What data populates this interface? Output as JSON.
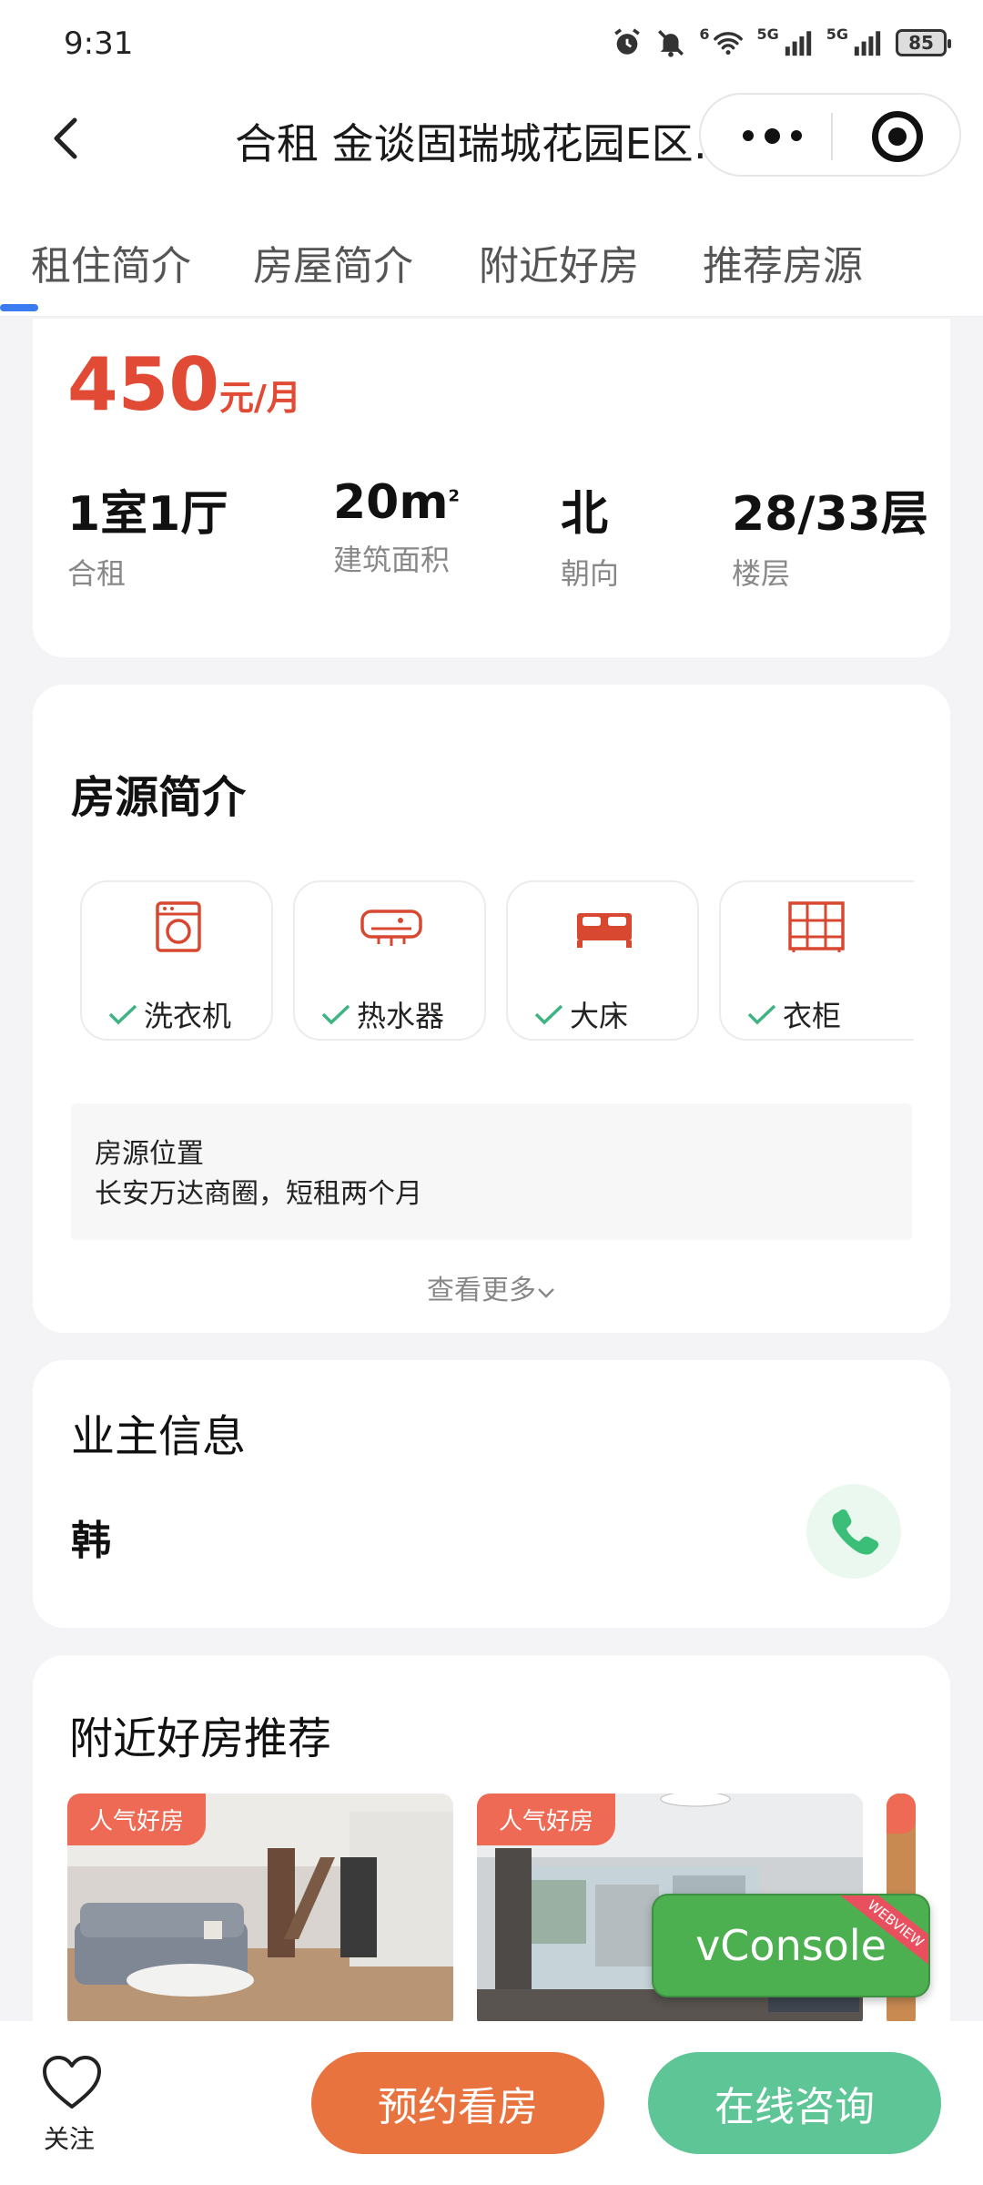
{
  "status_bar": {
    "time": "9:31",
    "battery": "85",
    "net1": "5G",
    "net2": "5G",
    "wifi_tag": "6"
  },
  "nav": {
    "title": "合租 金谈固瑞城花园E区…"
  },
  "tabs": [
    {
      "label": "租住简介"
    },
    {
      "label": "房屋简介"
    },
    {
      "label": "附近好房"
    },
    {
      "label": "推荐房源"
    }
  ],
  "summary": {
    "price_value": "450",
    "price_unit": "元/月",
    "stats": [
      {
        "value": "1室1厅",
        "label": "合租"
      },
      {
        "value": "20m",
        "sup": "2",
        "label": "建筑面积"
      },
      {
        "value": "北",
        "label": "朝向"
      },
      {
        "value": "28/33层",
        "label": "楼层"
      }
    ]
  },
  "intro": {
    "title": "房源简介",
    "amenities": [
      {
        "label": "洗衣机",
        "icon": "washing-machine-icon"
      },
      {
        "label": "热水器",
        "icon": "water-heater-icon"
      },
      {
        "label": "大床",
        "icon": "bed-icon"
      },
      {
        "label": "衣柜",
        "icon": "wardrobe-icon"
      }
    ],
    "location_title": "房源位置",
    "location_desc": "长安万达商圈，短租两个月",
    "more": "查看更多"
  },
  "owner": {
    "title": "业主信息",
    "name": "韩"
  },
  "nearby": {
    "title": "附近好房推荐",
    "badge1": "人气好房",
    "badge2": "人气好房"
  },
  "bottom": {
    "fav_label": "关注",
    "book": "预约看房",
    "consult": "在线咨询"
  },
  "vconsole": {
    "label": "vConsole",
    "ribbon": "WEBVIEW"
  },
  "colors": {
    "price": "#e14a35",
    "book": "#e8733f",
    "consult": "#5ec596",
    "accent": "#3a7cf0",
    "vconsole": "#4caf50"
  }
}
